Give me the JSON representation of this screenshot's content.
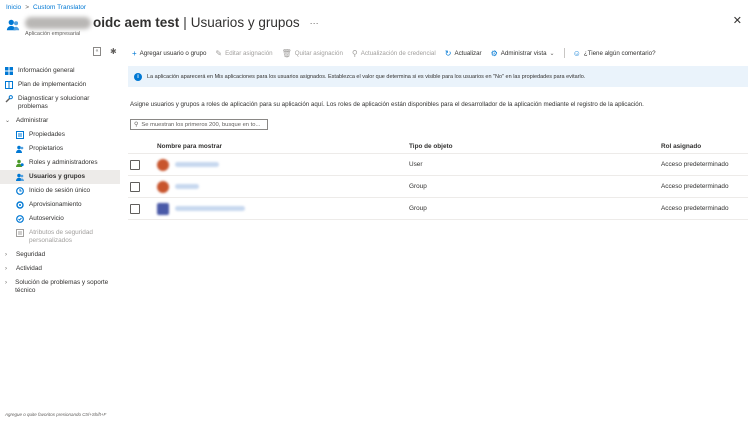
{
  "breadcrumb": {
    "home": "Inicio",
    "separator": ">",
    "current": "Custom Translator"
  },
  "header": {
    "title_visible": "oidc aem test",
    "separator": "|",
    "section": "Usuarios y grupos",
    "more": "···",
    "subtitle": "Aplicación empresarial",
    "close": "✕"
  },
  "sidebar": {
    "collapse": "«",
    "pin": "✱",
    "items": [
      {
        "label": "Información general"
      },
      {
        "label": "Plan de implementación"
      },
      {
        "label": "Diagnosticar y solucionar problemas"
      },
      {
        "label": "Administrar"
      },
      {
        "label": "Propiedades"
      },
      {
        "label": "Propietarios"
      },
      {
        "label": "Roles y administradores"
      },
      {
        "label": "Usuarios y grupos"
      },
      {
        "label": "Inicio de sesión único"
      },
      {
        "label": "Aprovisionamiento"
      },
      {
        "label": "Autoservicio"
      },
      {
        "label": "Atributos de seguridad personalizados"
      },
      {
        "label": "Seguridad"
      },
      {
        "label": "Actividad"
      },
      {
        "label": "Solución de problemas y soporte técnico"
      }
    ],
    "fav_hint": "Agregue o quite favoritos presionando Ctrl+Shift+F"
  },
  "toolbar": {
    "add": "Agregar usuario o grupo",
    "edit": "Editar asignación",
    "remove": "Quitar asignación",
    "update_credential": "Actualización de credencial",
    "refresh": "Actualizar",
    "manage_view": "Administrar vista",
    "feedback": "¿Tiene algún comentario?"
  },
  "info": {
    "text": "La aplicación aparecerá en Mis aplicaciones para los usuarios asignados. Establezca el valor que determina si es visible para los usuarios en \"No\" en las propiedades para evitarlo."
  },
  "description": "Asigne usuarios y grupos a roles de aplicación para su aplicación aquí. Los roles de aplicación están disponibles para el desarrollador de la aplicación mediante el registro de la aplicación.",
  "search": {
    "placeholder": "Se muestran los primeros 200, busque en to..."
  },
  "table": {
    "headers": {
      "name": "Nombre para mostrar",
      "type": "Tipo de objeto",
      "role": "Rol asignado"
    },
    "rows": [
      {
        "type": "User",
        "role": "Acceso predeterminado",
        "avatar_color": "#c8552d"
      },
      {
        "type": "Group",
        "role": "Acceso predeterminado",
        "avatar_color": "#c8552d"
      },
      {
        "type": "Group",
        "role": "Acceso predeterminado",
        "avatar_color": "#4a5aa8"
      }
    ]
  },
  "colors": {
    "accent": "#0078d4",
    "info_bg": "#eaf3fb",
    "active_nav": "#edebe9"
  }
}
